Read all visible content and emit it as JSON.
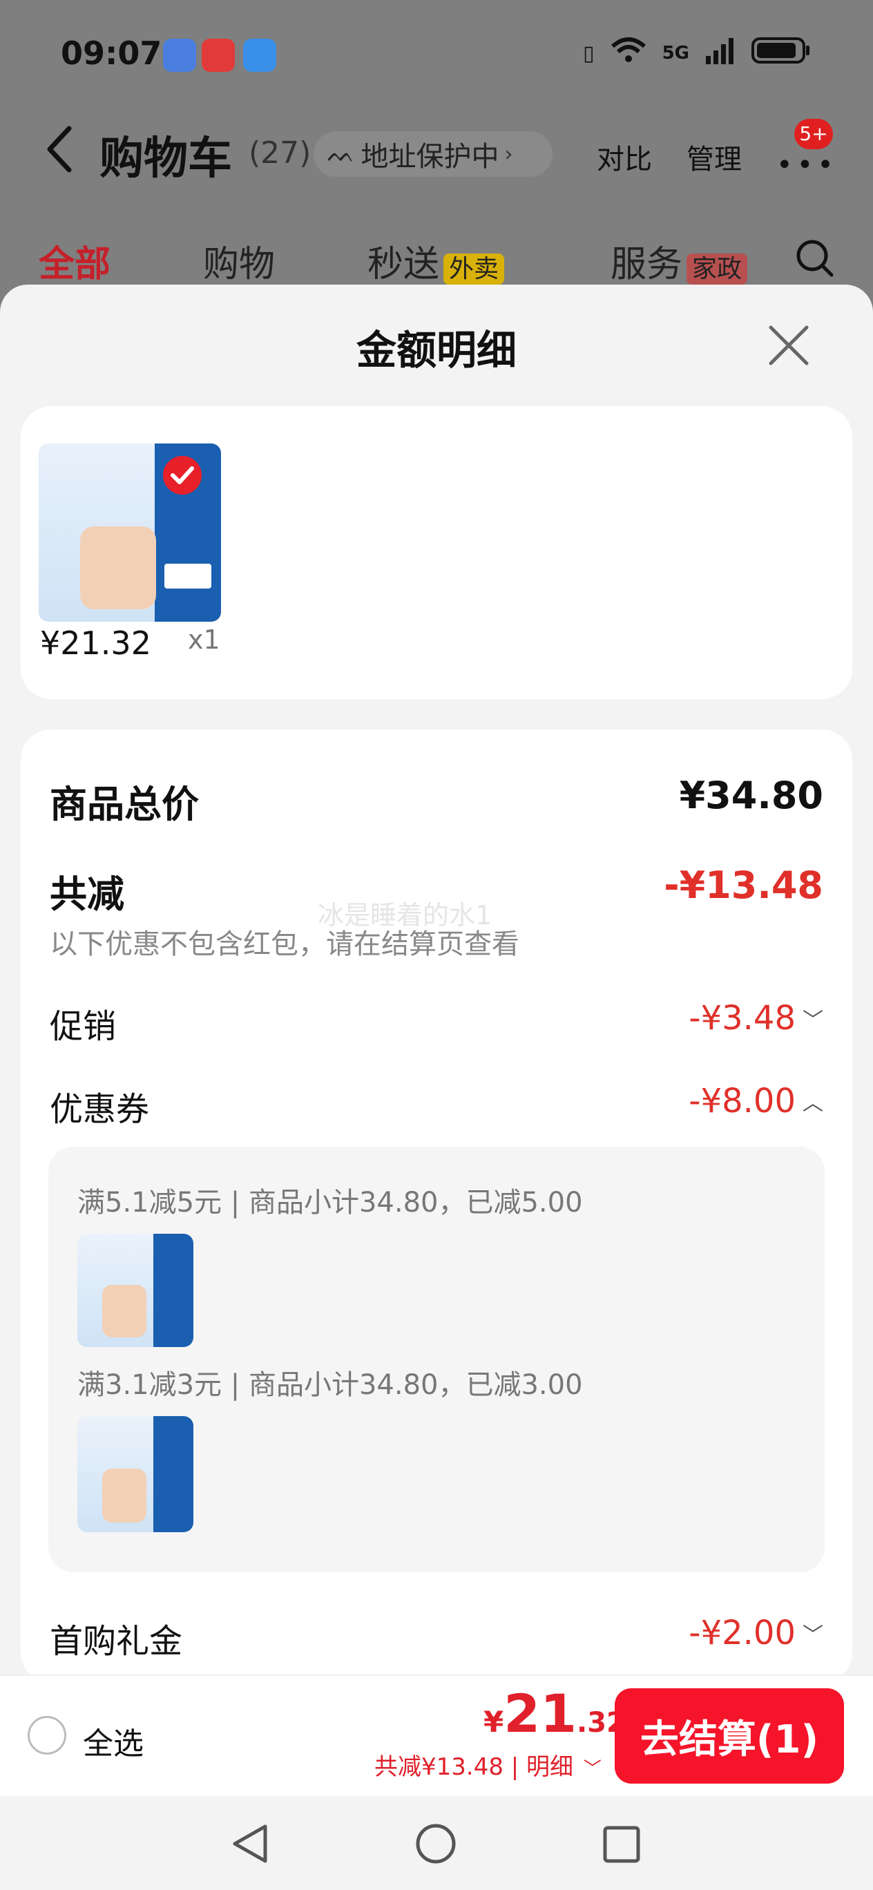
{
  "status_bar": {
    "time": "09:07",
    "network": "5G"
  },
  "header": {
    "title": "购物车",
    "count": "(27)",
    "address_protect": "地址保护中",
    "compare": "对比",
    "manage": "管理",
    "more_badge": "5+"
  },
  "tabs": [
    {
      "label": "全部"
    },
    {
      "label": "购物"
    },
    {
      "label": "秒送",
      "tag": "外卖"
    },
    {
      "label": "服务",
      "tag": "家政"
    }
  ],
  "sheet": {
    "title": "金额明细",
    "product": {
      "price": "¥21.32",
      "qty": "x1"
    },
    "rows": {
      "total_label": "商品总价",
      "total_value": "¥34.80",
      "reduce_label": "共减",
      "reduce_value": "-¥13.48",
      "reduce_note": "以下优惠不包含红包，请在结算页查看",
      "promo_label": "促销",
      "promo_value": "-¥3.48",
      "coupon_label": "优惠券",
      "coupon_value": "-¥8.00",
      "gift_label": "首购礼金",
      "gift_value": "-¥2.00"
    },
    "coupons": [
      {
        "text": "满5.1减5元 | 商品小计34.80，已减5.00"
      },
      {
        "text": "满3.1减3元 | 商品小计34.80，已减3.00"
      }
    ],
    "watermark": "冰是睡着的水1"
  },
  "bottom": {
    "select_all": "全选",
    "currency": "¥",
    "price_int": "21",
    "price_dec": ".32",
    "sub_text": "共减¥13.48 | 明细",
    "checkout": "去结算(1)"
  }
}
